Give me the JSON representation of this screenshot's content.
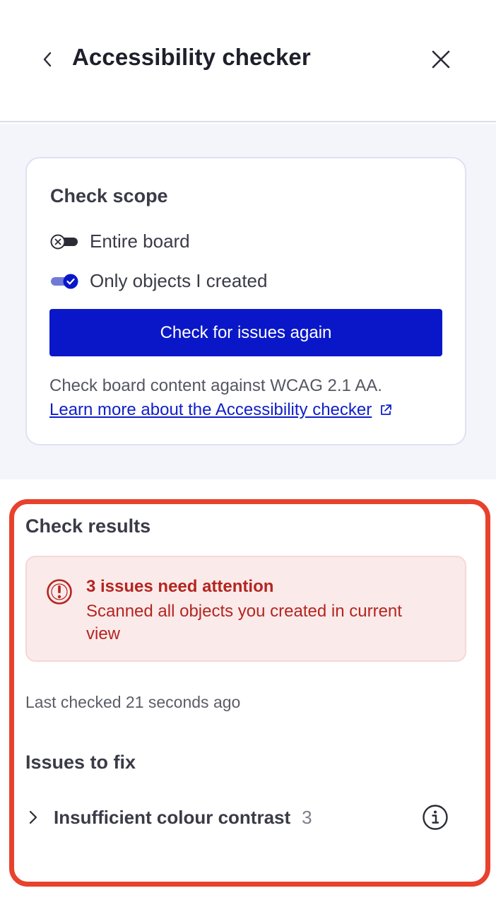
{
  "header": {
    "title": "Accessibility checker",
    "back_icon": "chevron-left-icon",
    "close_icon": "close-icon"
  },
  "scope": {
    "title": "Check scope",
    "options": [
      {
        "label": "Entire board",
        "checked": false
      },
      {
        "label": "Only objects I created",
        "checked": true
      }
    ],
    "button_label": "Check for issues again",
    "description": "Check board content against WCAG 2.1 AA.",
    "link_label": "Learn more about the Accessibility checker",
    "link_icon": "external-link-icon"
  },
  "results": {
    "title": "Check results",
    "alert": {
      "title": "3 issues need attention",
      "text": "Scanned all objects you created in current view",
      "icon": "alert-circle-icon"
    },
    "last_checked": "Last checked 21 seconds ago",
    "issues_title": "Issues to fix",
    "issues": [
      {
        "label": "Insufficient colour contrast",
        "count": "3",
        "icon": "info-icon"
      }
    ]
  },
  "colors": {
    "primary": "#0a17c9",
    "link": "#1020c8",
    "error_text": "#b42520",
    "error_bg": "#fbeaea",
    "highlight_outline": "#e8412c",
    "panel_bg": "#f4f5fb"
  }
}
